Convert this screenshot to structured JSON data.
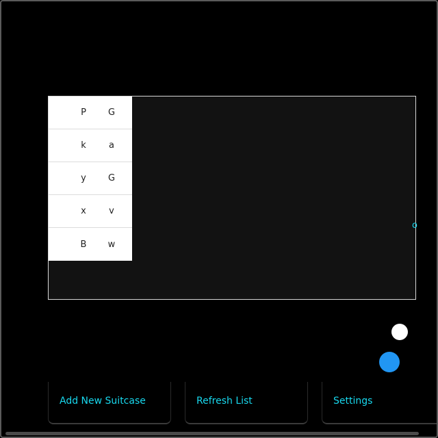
{
  "grid": {
    "rows": [
      [
        "P",
        "G"
      ],
      [
        "k",
        "a"
      ],
      [
        "y",
        "G"
      ],
      [
        "x",
        "v"
      ],
      [
        "B",
        "w"
      ]
    ]
  },
  "edge_glyph": "o",
  "buttons": {
    "add_label": "Add New Suitcase",
    "refresh_label": "Refresh List",
    "settings_label": "Settings"
  },
  "colors": {
    "accent": "#18d8ee",
    "fab_blue": "#2196f3",
    "background": "#000000",
    "panel": "#121212"
  },
  "icons": {
    "white_dot": "white-circle-icon",
    "blue_dot": "blue-circle-icon"
  }
}
